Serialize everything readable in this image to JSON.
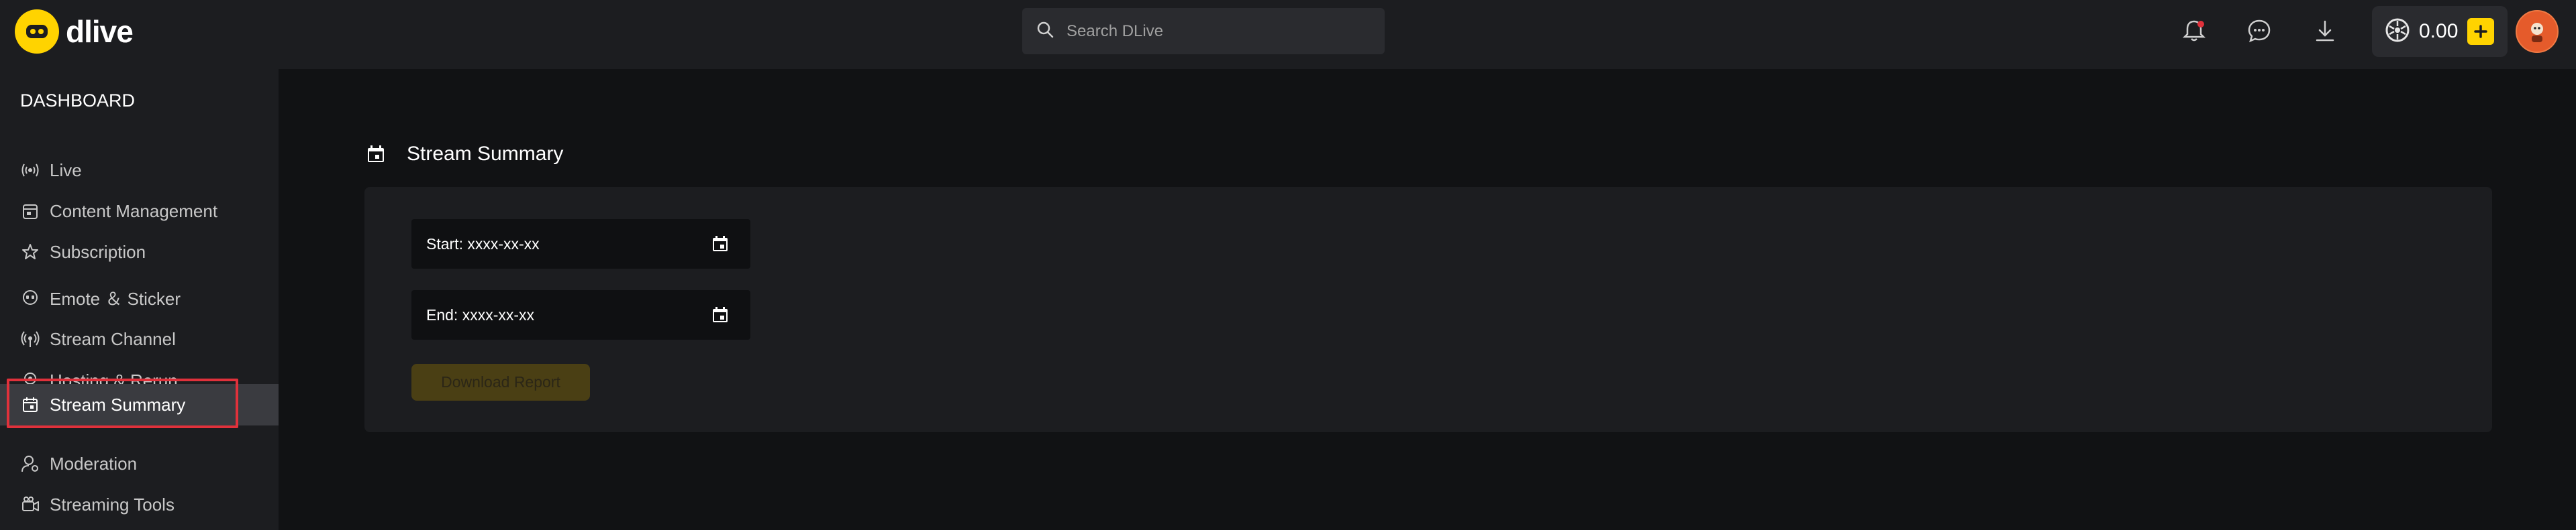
{
  "header": {
    "logo_text": "dlive",
    "search_placeholder": "Search DLive",
    "wallet_amount": "0.00",
    "icons": [
      "bell-icon",
      "chat-icon",
      "download-icon",
      "lemon-coin-icon",
      "plus-icon"
    ]
  },
  "sidebar": {
    "title": "DASHBOARD",
    "items": [
      {
        "label": "Live",
        "icon": "broadcast-icon"
      },
      {
        "label": "Content Management",
        "icon": "content-icon"
      },
      {
        "label": "Subscription",
        "icon": "star-icon"
      },
      {
        "label": "Emote ＆ Sticker",
        "icon": "emote-icon"
      },
      {
        "label": "Stream Channel",
        "icon": "channel-icon"
      },
      {
        "label": "Hosting & Rerun",
        "icon": "webcam-icon"
      },
      {
        "label": "Stream Summary",
        "icon": "calendar-icon",
        "active": true
      },
      {
        "label": "Moderation",
        "icon": "moderation-icon"
      },
      {
        "label": "Streaming Tools",
        "icon": "tools-icon"
      }
    ]
  },
  "main": {
    "title": "Stream Summary",
    "start_field": "Start: xxxx-xx-xx",
    "end_field": "End: xxxx-xx-xx",
    "download_label": "Download Report"
  },
  "colors": {
    "accent": "#ffd300",
    "highlight": "#e0313b",
    "background": "#111214",
    "panel": "#1c1d20"
  }
}
